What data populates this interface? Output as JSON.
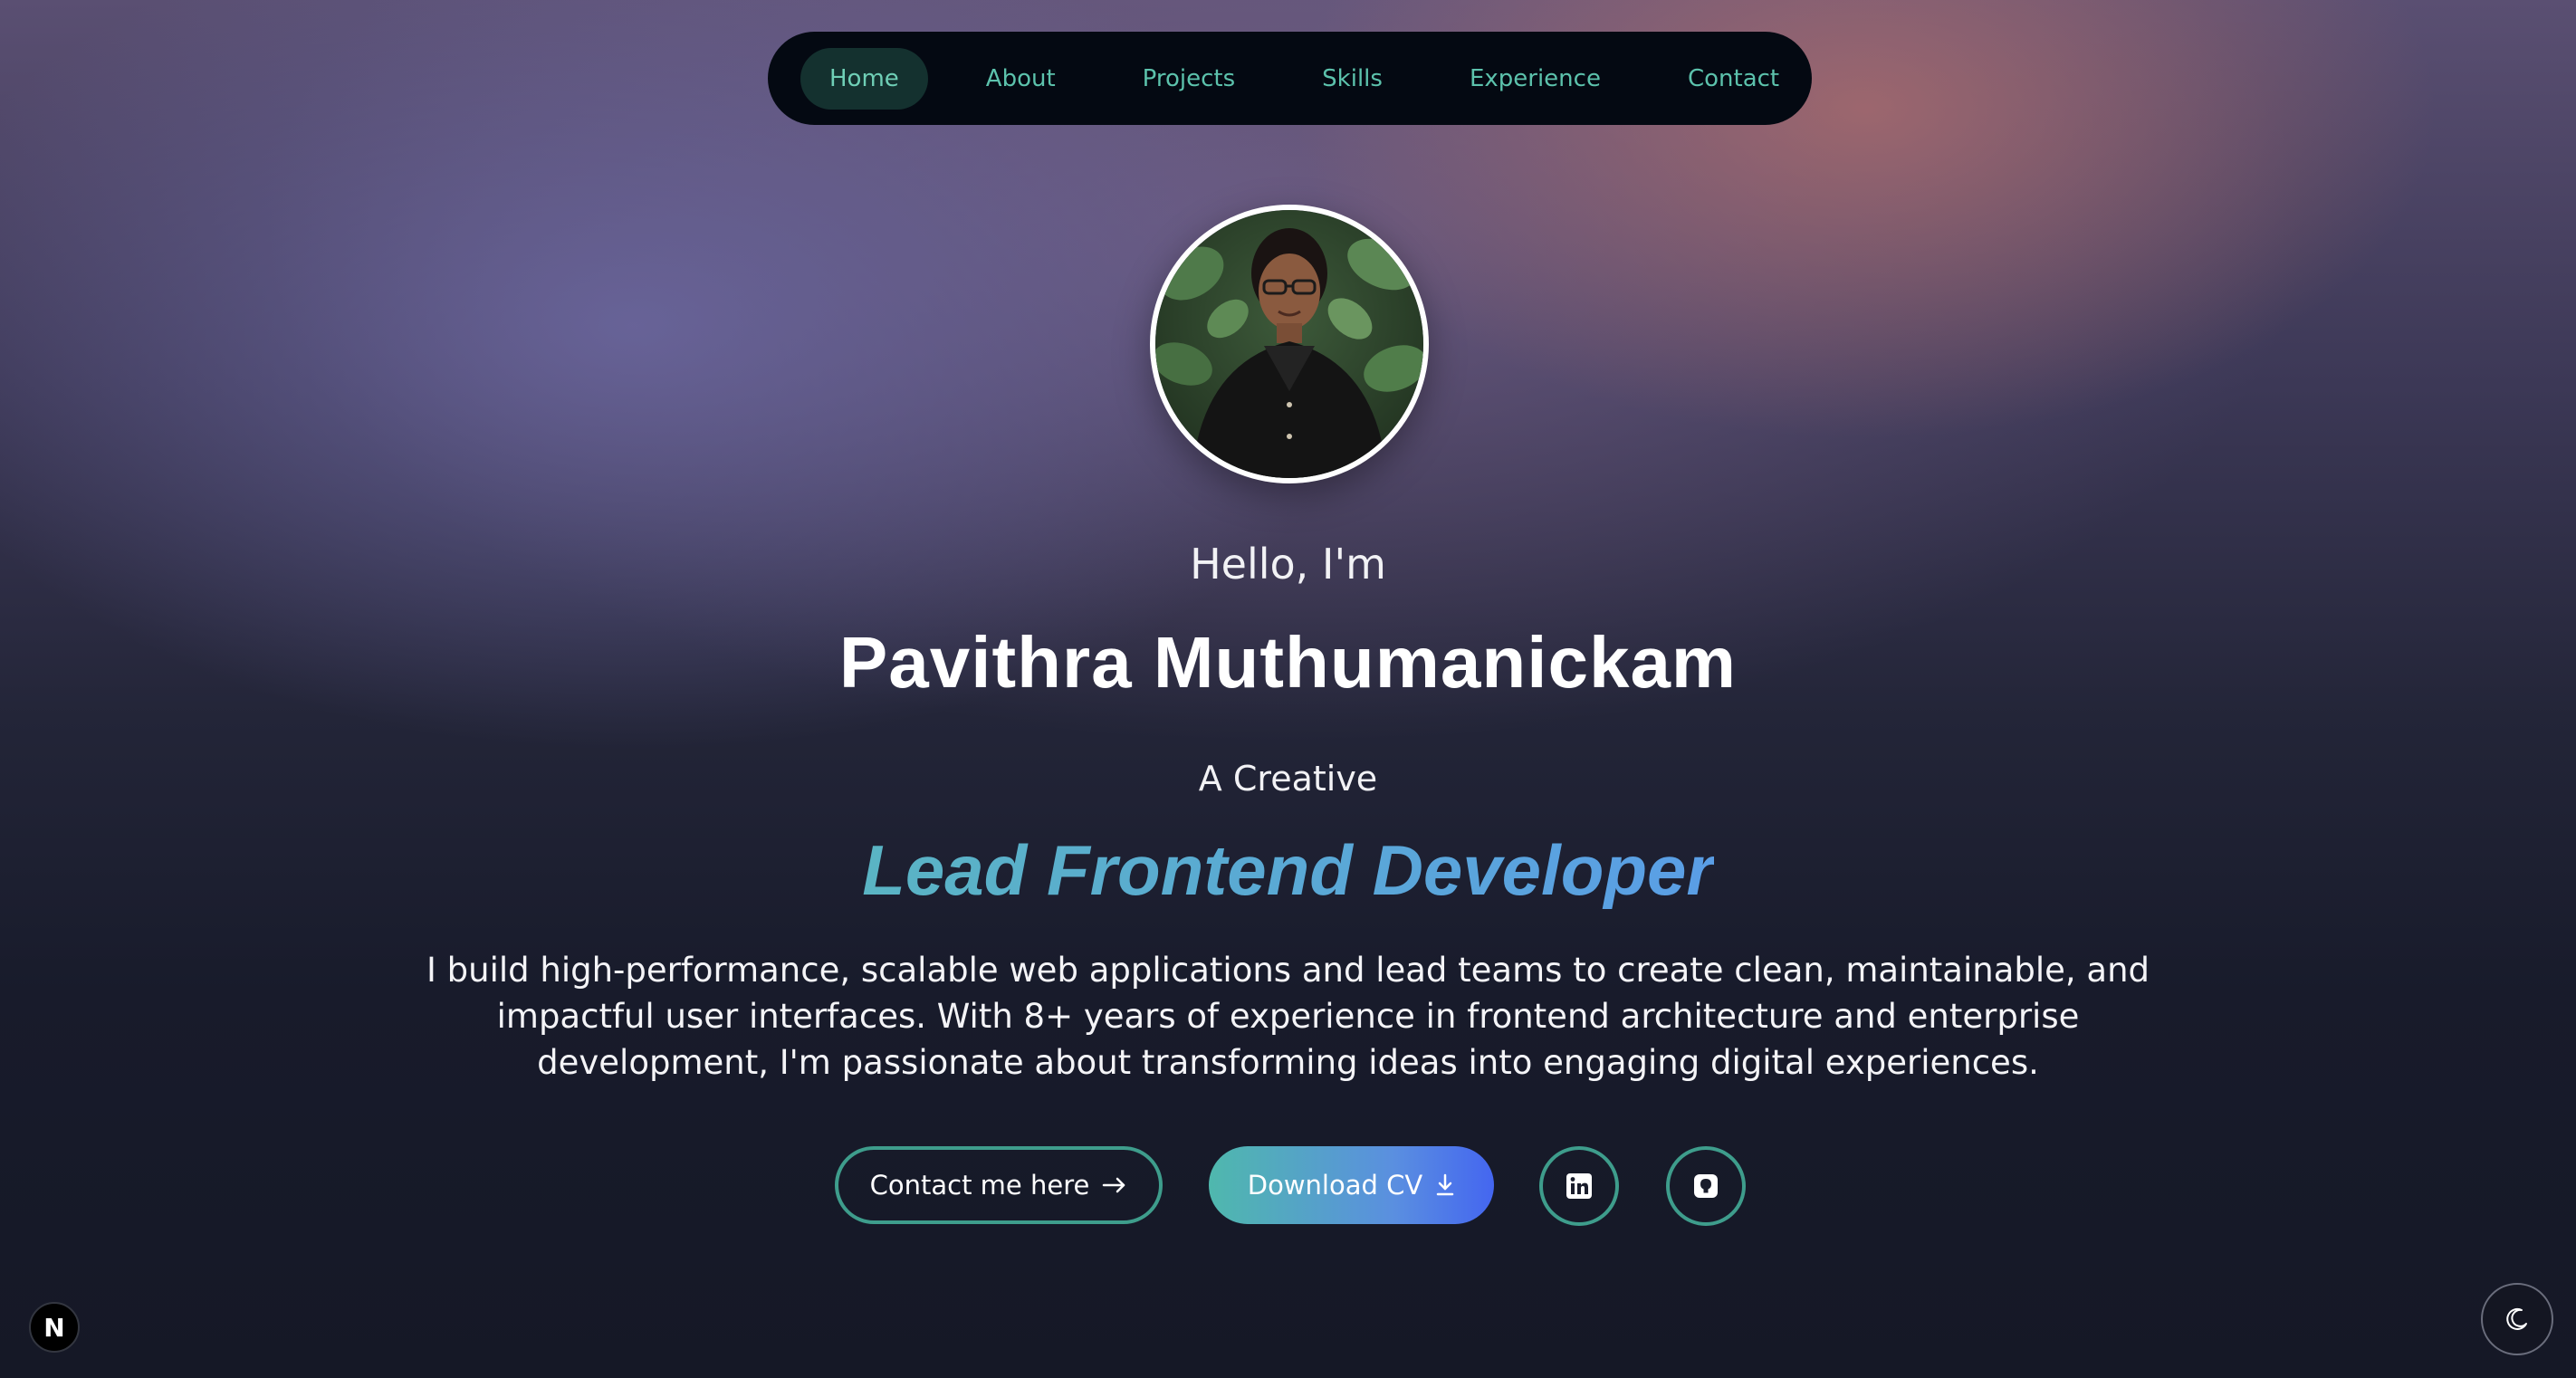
{
  "nav": {
    "items": [
      {
        "label": "Home",
        "active": true
      },
      {
        "label": "About"
      },
      {
        "label": "Projects"
      },
      {
        "label": "Skills"
      },
      {
        "label": "Experience"
      },
      {
        "label": "Contact"
      }
    ]
  },
  "hero": {
    "greeting": "Hello, I'm",
    "name": "Pavithra Muthumanickam",
    "tagline_prefix": "A Creative",
    "role": "Lead Frontend Developer",
    "bio": "I build high-performance, scalable web applications and lead teams to create clean, maintainable, and impactful user interfaces. With 8+ years of experience in frontend architecture and enterprise development, I'm passionate about transforming ideas into engaging digital experiences."
  },
  "actions": {
    "contact_label": "Contact me here",
    "contact_icon": "arrow-right-icon",
    "cv_label": "Download CV",
    "cv_icon": "download-icon",
    "linkedin_icon": "linkedin-icon",
    "github_icon": "github-icon"
  },
  "widgets": {
    "next_badge": "N",
    "theme_icon": "moon-icon"
  },
  "colors": {
    "accent": "#5cc2ac",
    "role_gradient_start": "#5ab4c4",
    "role_gradient_end": "#5a9ee6",
    "nav_bg": "#040912"
  }
}
